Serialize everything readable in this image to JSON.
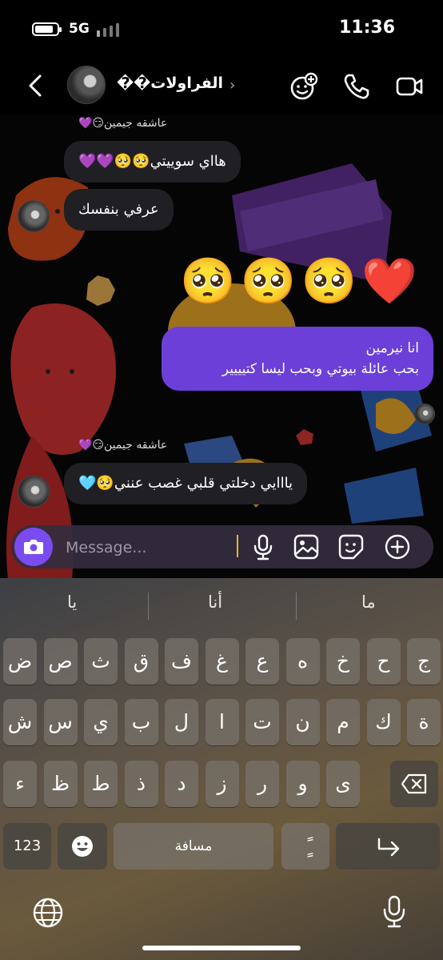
{
  "status_bar": {
    "network": "5G",
    "time": "11:36"
  },
  "header": {
    "title": "الفراولات��"
  },
  "messages": [
    {
      "type": "sender",
      "text": "عاشقه جيمين😏💜"
    },
    {
      "type": "in",
      "text": "هااي سوييتي🥺🥺💜💜"
    },
    {
      "type": "in",
      "text": "عرفي بنفسك"
    },
    {
      "type": "emoji",
      "text": "🥺🥺🥺❤️"
    },
    {
      "type": "out",
      "line1": "انا نيرمين",
      "line2": "بحب عائلة بيوتي وبحب ليسا كتيييير"
    },
    {
      "type": "sender",
      "text": "عاشقه جيمين😏💜"
    },
    {
      "type": "in",
      "text": "يااايي دخلتي قلبي غصب عنني🥺🩵"
    }
  ],
  "composer": {
    "placeholder": "Message..."
  },
  "keyboard": {
    "suggestions": [
      "يا",
      "أنا",
      "ما"
    ],
    "row1": [
      "ض",
      "ص",
      "ث",
      "ق",
      "ف",
      "غ",
      "ع",
      "ه",
      "خ",
      "ح",
      "ج"
    ],
    "row2": [
      "ش",
      "س",
      "ي",
      "ب",
      "ل",
      "ا",
      "ت",
      "ن",
      "م",
      "ك",
      "ة"
    ],
    "row3": [
      "ء",
      "ظ",
      "ط",
      "ذ",
      "د",
      "ز",
      "ر",
      "و",
      "ى"
    ],
    "numbers_key": "123",
    "space_key": "مسافة",
    "diacritic_key": "ًٍ"
  },
  "colors": {
    "outgoing_bubble": "#6b3fd8",
    "incoming_bubble": "#202024",
    "accent": "#7a4cf0"
  },
  "icons": [
    "back-icon",
    "video-chat-effects-icon",
    "phone-icon",
    "video-camera-icon",
    "camera-icon",
    "microphone-icon",
    "image-icon",
    "sticker-icon",
    "plus-icon",
    "emoji-icon",
    "backspace-icon",
    "return-icon",
    "globe-icon",
    "dictation-icon"
  ]
}
